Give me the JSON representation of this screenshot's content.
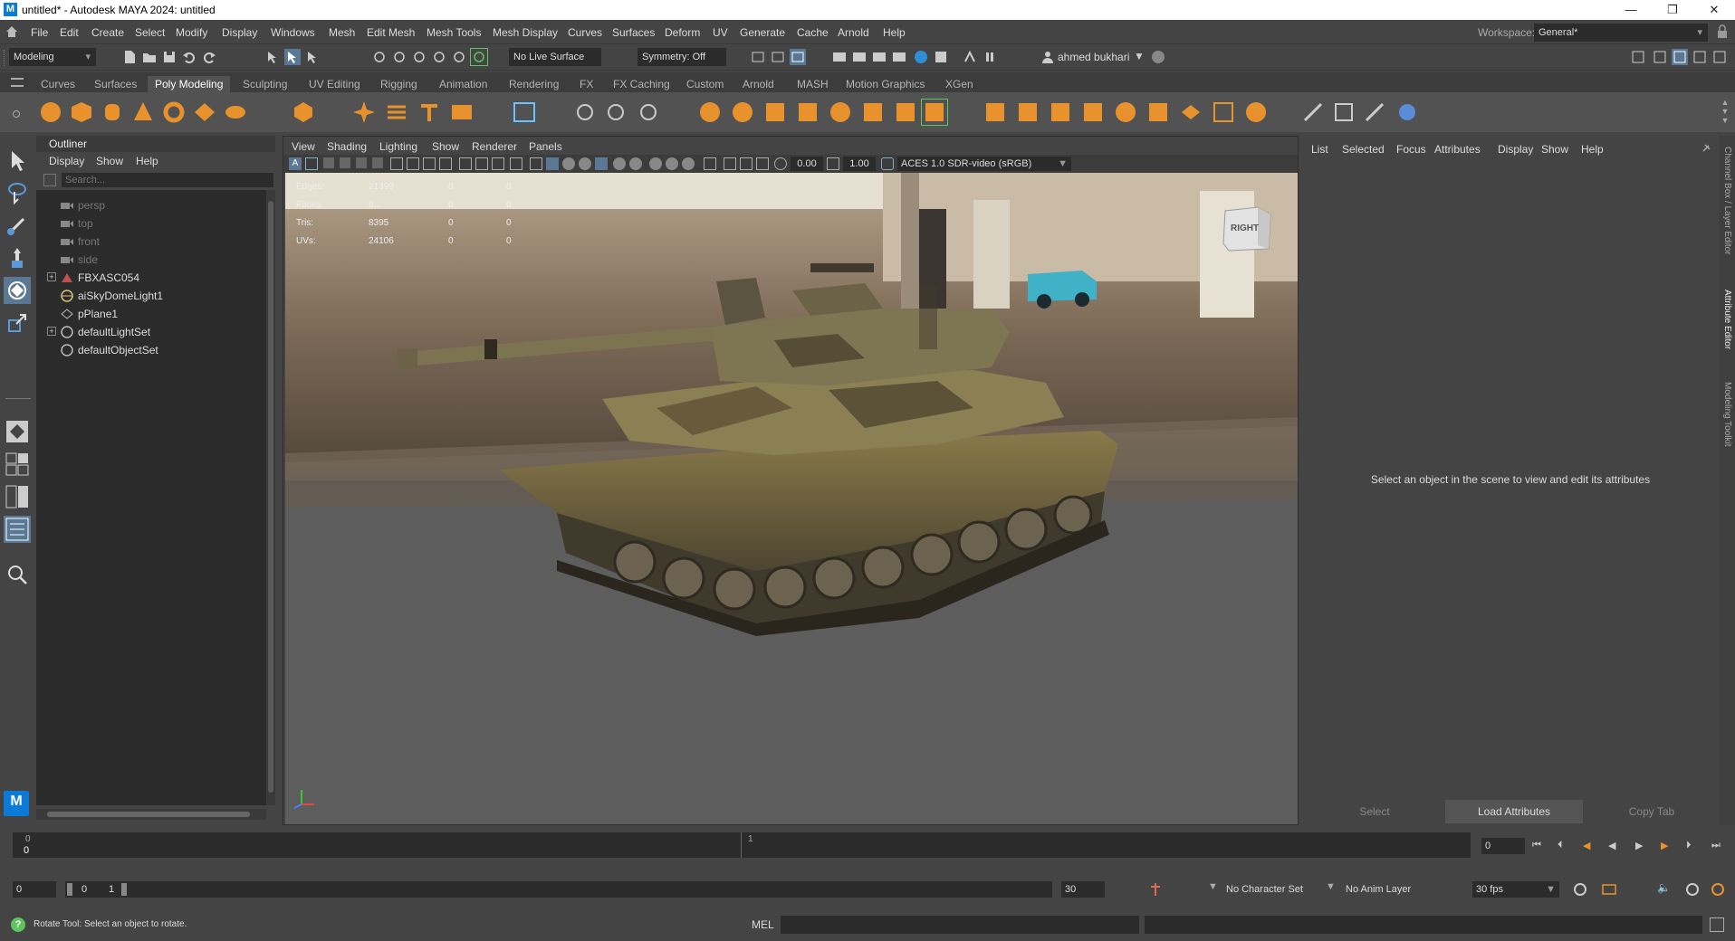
{
  "window": {
    "title": "untitled* - Autodesk MAYA 2024: untitled",
    "logo_letter": "M"
  },
  "menu": [
    "File",
    "Edit",
    "Create",
    "Select",
    "Modify",
    "Display",
    "Windows",
    "Mesh",
    "Edit Mesh",
    "Mesh Tools",
    "Mesh Display",
    "Curves",
    "Surfaces",
    "Deform",
    "UV",
    "Generate",
    "Cache",
    "Arnold",
    "Help"
  ],
  "workspace": {
    "label": "Workspace:",
    "value": "General*"
  },
  "statusline": {
    "menuset": "Modeling",
    "live_surface": "No Live Surface",
    "symmetry": "Symmetry: Off",
    "user": "ahmed bukhari"
  },
  "shelf_tabs": [
    "Curves",
    "Surfaces",
    "Poly Modeling",
    "Sculpting",
    "UV Editing",
    "Rigging",
    "Animation",
    "Rendering",
    "FX",
    "FX Caching",
    "Custom",
    "Arnold",
    "MASH",
    "Motion Graphics",
    "XGen"
  ],
  "shelf_active_tab": "Poly Modeling",
  "outliner": {
    "title": "Outliner",
    "menu": [
      "Display",
      "Show",
      "Help"
    ],
    "search_placeholder": "Search...",
    "items": [
      "persp",
      "top",
      "front",
      "side",
      "FBXASC054",
      "aiSkyDomeLight1",
      "pPlane1",
      "defaultLightSet",
      "defaultObjectSet"
    ]
  },
  "viewport": {
    "menu": [
      "View",
      "Shading",
      "Lighting",
      "Show",
      "Renderer",
      "Panels"
    ],
    "exposure": "0.00",
    "gamma": "1.00",
    "color_space": "ACES 1.0 SDR-video (sRGB)",
    "viewcube_label": "RIGHT",
    "hud": [
      {
        "label": "Edges:",
        "value": "21399",
        "c2": "0",
        "c3": "0"
      },
      {
        "label": "Faces:",
        "value": "8...",
        "c2": "0",
        "c3": "0"
      },
      {
        "label": "Tris:",
        "value": "8395",
        "c2": "0",
        "c3": "0"
      },
      {
        "label": "UVs:",
        "value": "24106",
        "c2": "0",
        "c3": "0"
      }
    ]
  },
  "attribute_editor": {
    "menu": [
      "List",
      "Selected",
      "Focus",
      "Attributes",
      "Display",
      "Show",
      "Help"
    ],
    "empty_message": "Select an object in the scene to view and edit its attributes",
    "buttons": [
      "Select",
      "Load Attributes",
      "Copy Tab"
    ]
  },
  "side_tabs": [
    "Channel Box / Layer Editor",
    "Attribute Editor",
    "Modeling Toolkit"
  ],
  "timeline": {
    "start_tick": "0",
    "current_frame_marker": "0",
    "mid_tick": "1",
    "current_frame": "0"
  },
  "range": {
    "start": "0",
    "inner_start": "0",
    "inner_end": "1",
    "end": "30",
    "character_set": "No Character Set",
    "anim_layer": "No Anim Layer",
    "fps": "30 fps"
  },
  "help_line": {
    "message": "Rotate Tool: Select an object to rotate.",
    "cmd_lang": "MEL"
  }
}
